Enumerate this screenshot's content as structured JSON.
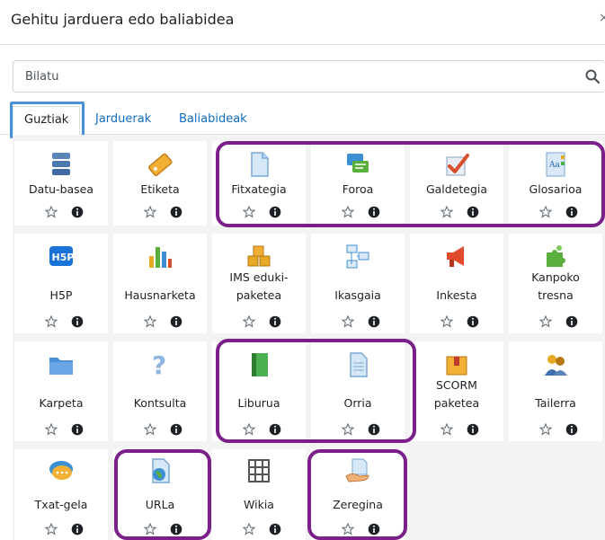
{
  "dialog": {
    "title": "Gehitu jarduera edo baliabidea"
  },
  "search": {
    "placeholder": "Bilatu"
  },
  "tabs": [
    {
      "label": "Guztiak",
      "active": true
    },
    {
      "label": "Jarduerak",
      "active": false
    },
    {
      "label": "Baliabideak",
      "active": false
    }
  ],
  "modules": [
    {
      "line1": "Datu-basea",
      "line2": "",
      "icon": "database-icon",
      "highlighted": false
    },
    {
      "line1": "Etiketa",
      "line2": "",
      "icon": "label-tag-icon",
      "highlighted": false
    },
    {
      "line1": "Fitxategia",
      "line2": "",
      "icon": "file-icon",
      "highlighted": true
    },
    {
      "line1": "Foroa",
      "line2": "",
      "icon": "forum-icon",
      "highlighted": true
    },
    {
      "line1": "Galdetegia",
      "line2": "",
      "icon": "quiz-icon",
      "highlighted": true
    },
    {
      "line1": "Glosarioa",
      "line2": "",
      "icon": "glossary-icon",
      "highlighted": true
    },
    {
      "line1": "H5P",
      "line2": "",
      "icon": "h5p-icon",
      "highlighted": false
    },
    {
      "line1": "Hausnarketa",
      "line2": "",
      "icon": "choice-bar-chart-icon",
      "highlighted": false
    },
    {
      "line1": "IMS eduki-",
      "line2": "paketea",
      "icon": "ims-package-icon",
      "highlighted": false
    },
    {
      "line1": "Ikasgaia",
      "line2": "",
      "icon": "lesson-icon",
      "highlighted": false
    },
    {
      "line1": "Inkesta",
      "line2": "",
      "icon": "survey-megaphone-icon",
      "highlighted": false
    },
    {
      "line1": "Kanpoko",
      "line2": "tresna",
      "icon": "external-tool-puzzle-icon",
      "highlighted": false
    },
    {
      "line1": "Karpeta",
      "line2": "",
      "icon": "folder-icon",
      "highlighted": false
    },
    {
      "line1": "Kontsulta",
      "line2": "",
      "icon": "question-icon",
      "highlighted": false
    },
    {
      "line1": "Liburua",
      "line2": "",
      "icon": "book-icon",
      "highlighted": true
    },
    {
      "line1": "Orria",
      "line2": "",
      "icon": "page-icon",
      "highlighted": true
    },
    {
      "line1": "SCORM",
      "line2": "paketea",
      "icon": "scorm-package-icon",
      "highlighted": false
    },
    {
      "line1": "Tailerra",
      "line2": "",
      "icon": "workshop-people-icon",
      "highlighted": false
    },
    {
      "line1": "Txat-gela",
      "line2": "",
      "icon": "chat-bubbles-icon",
      "highlighted": false
    },
    {
      "line1": "URLa",
      "line2": "",
      "icon": "url-globe-icon",
      "highlighted": true
    },
    {
      "line1": "Wikia",
      "line2": "",
      "icon": "wiki-icon",
      "highlighted": false
    },
    {
      "line1": "Zeregina",
      "line2": "",
      "icon": "assignment-hand-icon",
      "highlighted": true
    }
  ],
  "colors": {
    "accent": "#0f6cbf",
    "highlight": "#7b1f8a",
    "focus": "#4a90d9",
    "background": "#f3f3f4"
  }
}
